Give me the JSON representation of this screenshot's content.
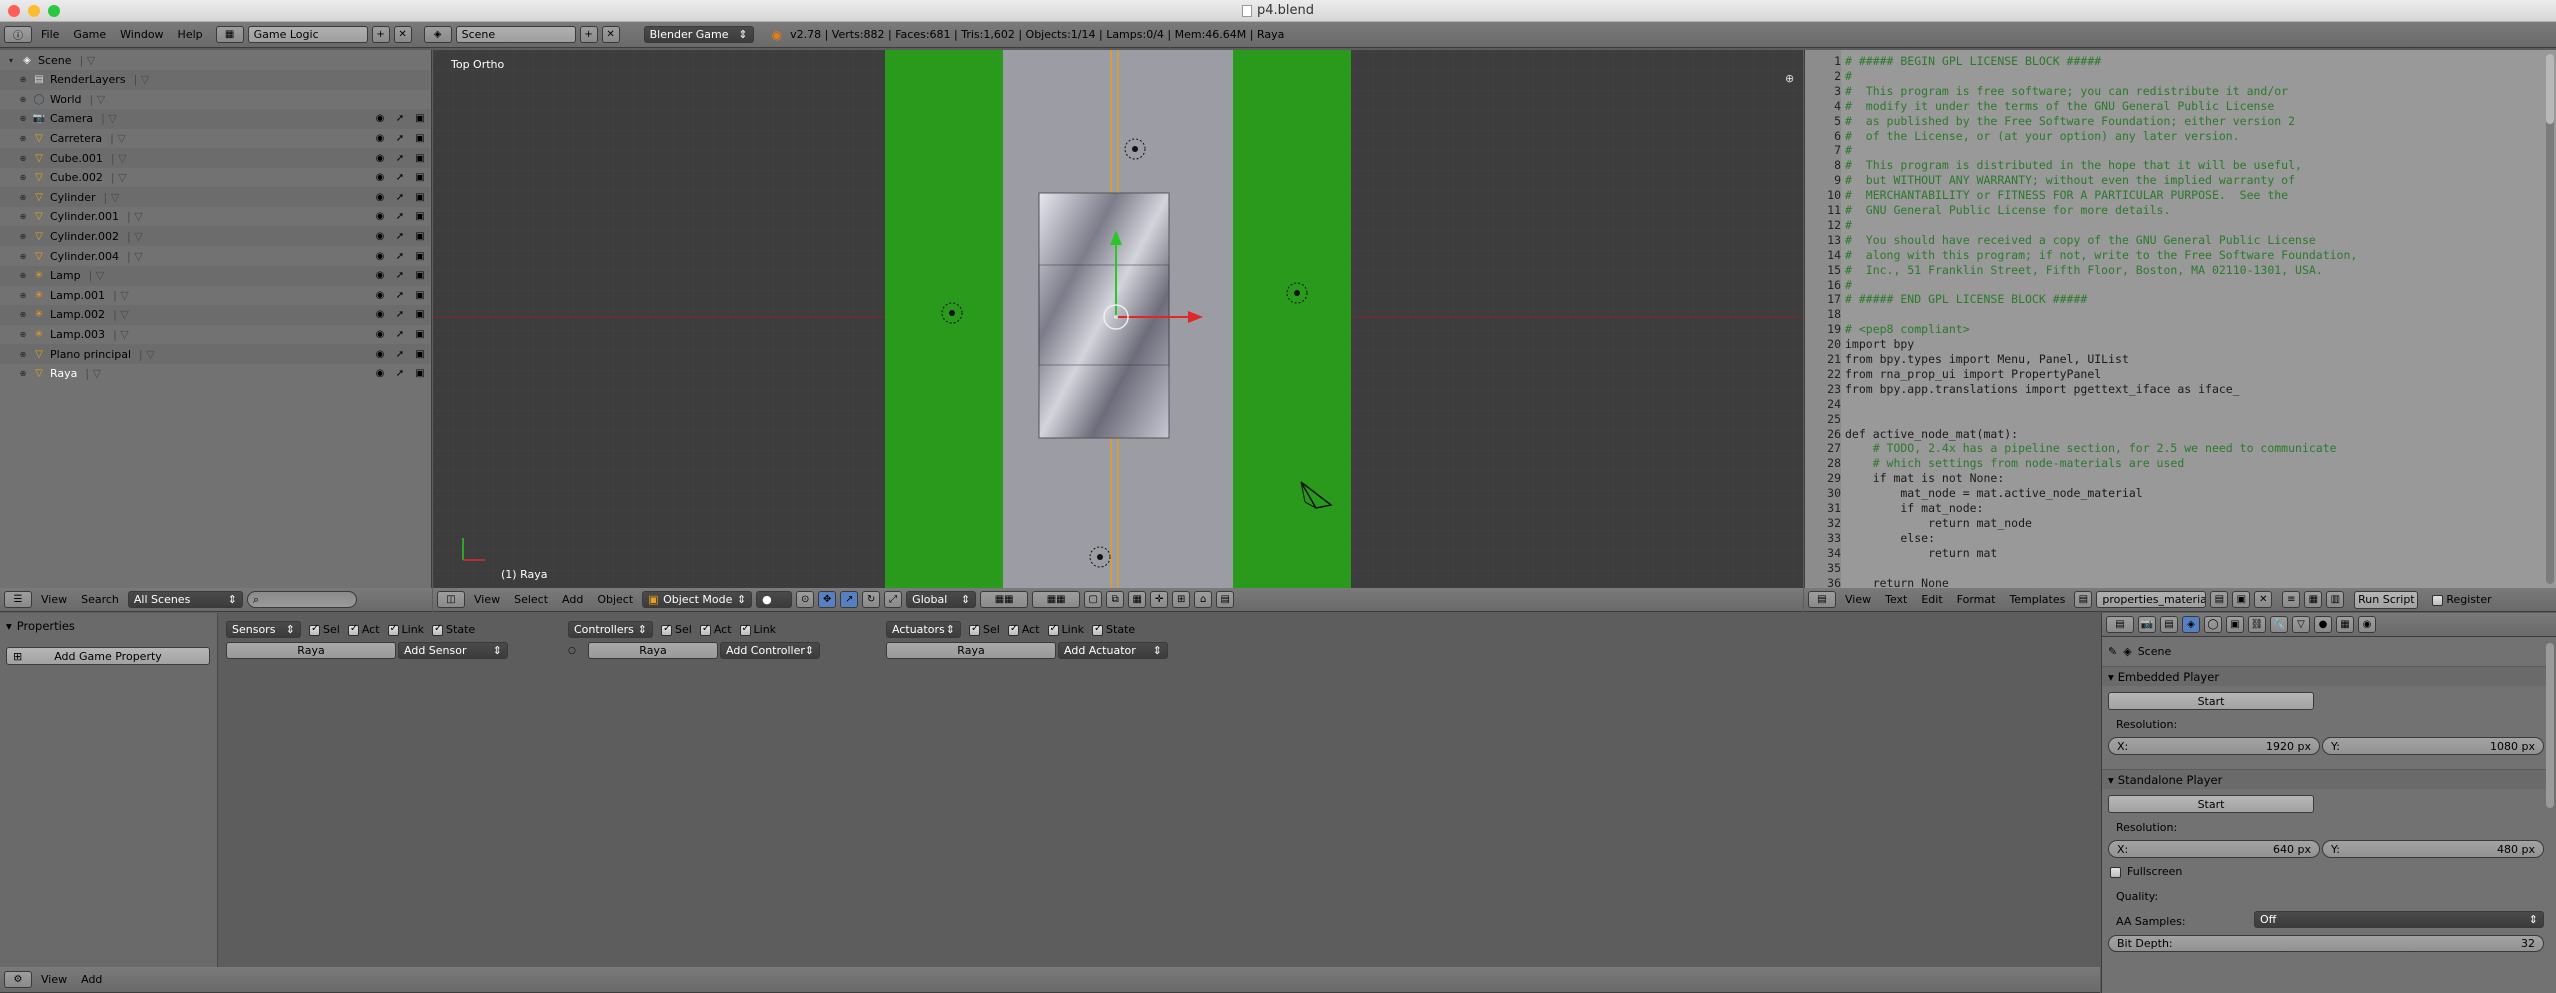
{
  "window": {
    "title": "p4.blend"
  },
  "info_header": {
    "menus": [
      "File",
      "Game",
      "Window",
      "Help"
    ],
    "screen_layout": "Game Logic",
    "scene": "Scene",
    "engine": "Blender Game",
    "stats": "v2.78 | Verts:882 | Faces:681 | Tris:1,602 | Objects:1/14 | Lamps:0/4 | Mem:46.64M | Raya"
  },
  "outliner": {
    "rows": [
      {
        "name": "Scene",
        "indent": 0,
        "icon": "scene-icon",
        "vis": false
      },
      {
        "name": "RenderLayers",
        "indent": 1,
        "icon": "renderlayers-icon",
        "vis": false
      },
      {
        "name": "World",
        "indent": 1,
        "icon": "world-icon",
        "vis": false
      },
      {
        "name": "Camera",
        "indent": 1,
        "icon": "camera-icon",
        "vis": true
      },
      {
        "name": "Carretera",
        "indent": 1,
        "icon": "mesh-icon",
        "vis": true
      },
      {
        "name": "Cube.001",
        "indent": 1,
        "icon": "mesh-icon",
        "vis": true
      },
      {
        "name": "Cube.002",
        "indent": 1,
        "icon": "mesh-icon",
        "vis": true
      },
      {
        "name": "Cylinder",
        "indent": 1,
        "icon": "mesh-icon",
        "vis": true
      },
      {
        "name": "Cylinder.001",
        "indent": 1,
        "icon": "mesh-icon",
        "vis": true
      },
      {
        "name": "Cylinder.002",
        "indent": 1,
        "icon": "mesh-icon",
        "vis": true
      },
      {
        "name": "Cylinder.004",
        "indent": 1,
        "icon": "mesh-icon",
        "vis": true
      },
      {
        "name": "Lamp",
        "indent": 1,
        "icon": "lamp-icon",
        "vis": true
      },
      {
        "name": "Lamp.001",
        "indent": 1,
        "icon": "lamp-icon",
        "vis": true
      },
      {
        "name": "Lamp.002",
        "indent": 1,
        "icon": "lamp-icon",
        "vis": true
      },
      {
        "name": "Lamp.003",
        "indent": 1,
        "icon": "lamp-icon",
        "vis": true
      },
      {
        "name": "Plano principal",
        "indent": 1,
        "icon": "mesh-icon",
        "vis": true
      },
      {
        "name": "Raya",
        "indent": 1,
        "icon": "mesh-icon",
        "vis": true,
        "selected": true
      }
    ],
    "footer": {
      "view": "View",
      "search": "Search",
      "filter": "All Scenes"
    }
  },
  "viewport": {
    "label": "Top Ortho",
    "object_label": "(1) Raya",
    "footer": {
      "view": "View",
      "select": "Select",
      "add": "Add",
      "object": "Object",
      "mode": "Object Mode",
      "orientation": "Global"
    }
  },
  "text_editor": {
    "lines": [
      "# ##### BEGIN GPL LICENSE BLOCK #####",
      "#",
      "#  This program is free software; you can redistribute it and/or",
      "#  modify it under the terms of the GNU General Public License",
      "#  as published by the Free Software Foundation; either version 2",
      "#  of the License, or (at your option) any later version.",
      "#",
      "#  This program is distributed in the hope that it will be useful,",
      "#  but WITHOUT ANY WARRANTY; without even the implied warranty of",
      "#  MERCHANTABILITY or FITNESS FOR A PARTICULAR PURPOSE.  See the",
      "#  GNU General Public License for more details.",
      "#",
      "#  You should have received a copy of the GNU General Public License",
      "#  along with this program; if not, write to the Free Software Foundation,",
      "#  Inc., 51 Franklin Street, Fifth Floor, Boston, MA 02110-1301, USA.",
      "#",
      "# ##### END GPL LICENSE BLOCK #####",
      "",
      "# <pep8 compliant>",
      "import bpy",
      "from bpy.types import Menu, Panel, UIList",
      "from rna_prop_ui import PropertyPanel",
      "from bpy.app.translations import pgettext_iface as iface_",
      "",
      "",
      "def active_node_mat(mat):",
      "    # TODO, 2.4x has a pipeline section, for 2.5 we need to communicate",
      "    # which settings from node-materials are used",
      "    if mat is not None:",
      "        mat_node = mat.active_node_material",
      "        if mat_node:",
      "            return mat_node",
      "        else:",
      "            return mat",
      "",
      "    return None"
    ],
    "footer": {
      "view": "View",
      "text": "Text",
      "edit": "Edit",
      "format": "Format",
      "templates": "Templates",
      "file": "properties_material...",
      "run": "Run Script",
      "register": "Register"
    }
  },
  "logic": {
    "properties_title": "Properties",
    "add_property": "Add Game Property",
    "sensors": {
      "title": "Sensors",
      "obj": "Raya",
      "add": "Add Sensor"
    },
    "controllers": {
      "title": "Controllers",
      "obj": "Raya",
      "add": "Add Controller"
    },
    "actuators": {
      "title": "Actuators",
      "obj": "Raya",
      "add": "Add Actuator"
    },
    "flags": {
      "sel": "Sel",
      "act": "Act",
      "link": "Link",
      "state": "State"
    },
    "footer": {
      "view": "View",
      "add": "Add"
    }
  },
  "props": {
    "context": "Scene",
    "embedded": {
      "title": "Embedded Player",
      "start": "Start",
      "res_label": "Resolution:",
      "x_label": "X:",
      "x": "1920 px",
      "y_label": "Y:",
      "y": "1080 px"
    },
    "standalone": {
      "title": "Standalone Player",
      "start": "Start",
      "res_label": "Resolution:",
      "x_label": "X:",
      "x": "640 px",
      "y_label": "Y:",
      "y": "480 px",
      "fullscreen": "Fullscreen",
      "quality": "Quality:",
      "aa_label": "AA Samples:",
      "aa": "Off",
      "depth_label": "Bit Depth:",
      "depth": "32"
    }
  }
}
